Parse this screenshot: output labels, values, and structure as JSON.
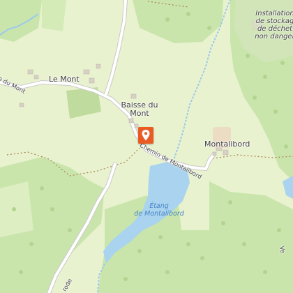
{
  "map": {
    "places": {
      "le_mont": "Le Mont",
      "baisse_du_mont_line1": "Baisse du",
      "baisse_du_mont_line2": "Mont",
      "montalibord": "Montalibord"
    },
    "water": {
      "etang_line1": "Étang",
      "etang_line2": "de Montalibord"
    },
    "roads": {
      "chemin_montalibord": "Chemin de Montalibord",
      "du_mont": "e du Mont",
      "bottom_road": "rode",
      "right_edge_road": "Ve"
    },
    "poi": {
      "line1": "Installation",
      "line2": "de stockag",
      "line3": "de déchet",
      "line4": "non danger"
    },
    "colors": {
      "meadow": "#e9f2cf",
      "forest": "#c9e5ac",
      "water": "#a9d3ee",
      "road": "#ffffff",
      "marker": "#ea5b24"
    },
    "marker_icon": "location-pin-icon"
  }
}
